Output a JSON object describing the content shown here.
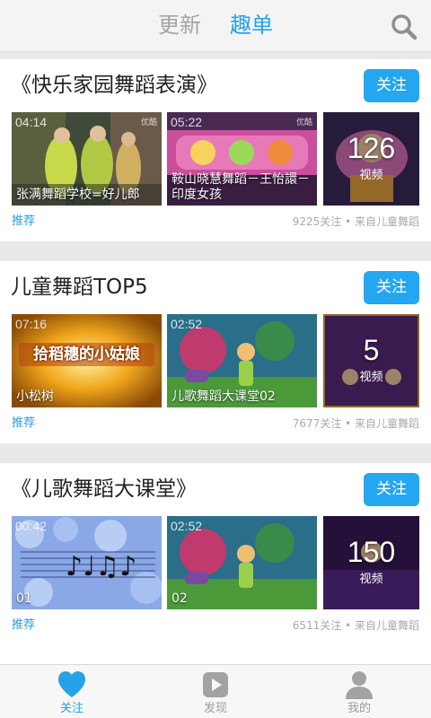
{
  "header": {
    "tabs": [
      {
        "label": "更新",
        "active": false
      },
      {
        "label": "趣单",
        "active": true
      }
    ],
    "search_icon": "search-icon",
    "accent_color": "#26a2e6"
  },
  "cards": [
    {
      "title": "《快乐家园舞蹈表演》",
      "follow_label": "关注",
      "videos": [
        {
          "duration": "04:14",
          "title": "张满舞蹈学校=好儿郎",
          "logo": "优酷"
        },
        {
          "duration": "05:22",
          "title": "鞍山晓慧舞蹈－王怡譞－印度女孩",
          "logo": "优酷"
        }
      ],
      "count": "126",
      "count_label": "视频",
      "tag": "推荐",
      "meta": "9225关注 • 来自儿童舞蹈"
    },
    {
      "title": "儿童舞蹈TOP5",
      "follow_label": "关注",
      "videos": [
        {
          "duration": "07:16",
          "title": "小松树",
          "banner": "拾稻穗的小姑娘"
        },
        {
          "duration": "02:52",
          "title": "儿歌舞蹈大课堂02"
        }
      ],
      "count": "5",
      "count_label": "视频",
      "tag": "推荐",
      "meta": "7677关注 • 来自儿童舞蹈"
    },
    {
      "title": "《儿歌舞蹈大课堂》",
      "follow_label": "关注",
      "videos": [
        {
          "duration": "00:42",
          "title": "01"
        },
        {
          "duration": "02:52",
          "title": "02"
        }
      ],
      "count": "150",
      "count_label": "视频",
      "tag": "推荐",
      "meta": "6511关注 • 来自儿童舞蹈"
    }
  ],
  "bottom_nav": [
    {
      "label": "关注",
      "icon": "heart-icon",
      "active": true
    },
    {
      "label": "发现",
      "icon": "play-icon",
      "active": false
    },
    {
      "label": "我的",
      "icon": "person-icon",
      "active": false
    }
  ]
}
